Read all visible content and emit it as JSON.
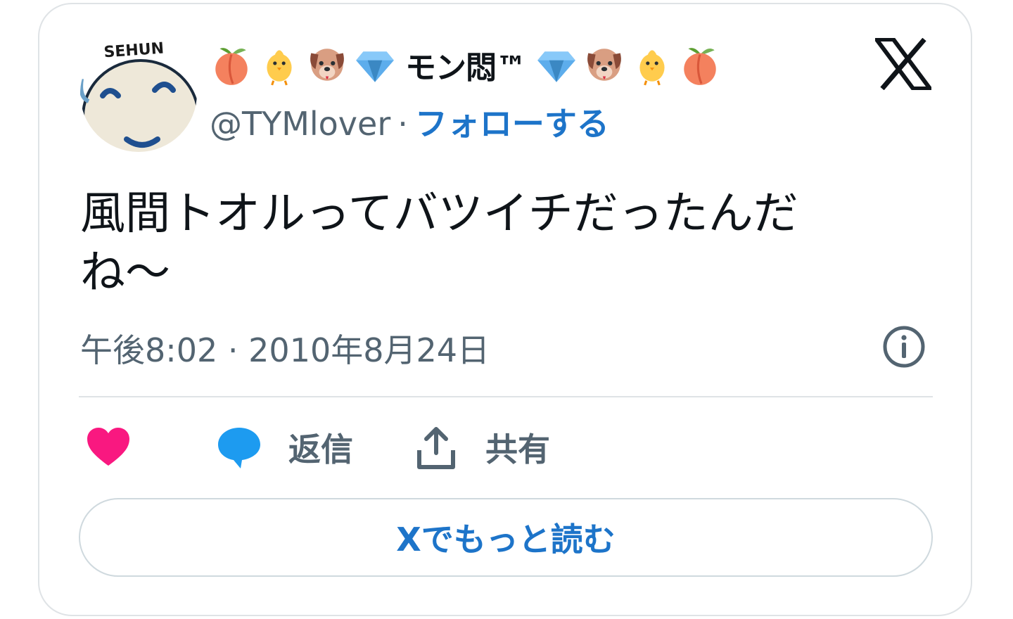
{
  "tweet": {
    "avatar_text": "SEHUN",
    "display_name": "モン悶™",
    "handle": "@TYMlover",
    "separator": "·",
    "follow_label": "フォローする",
    "text_line1": "風間トオルってバツイチだったんだ",
    "text_line2": "ね〜",
    "timestamp": "午後8:02 · 2010年8月24日"
  },
  "actions": {
    "like_icon": "heart-icon",
    "reply_label": "返信",
    "share_label": "共有"
  },
  "read_more_label": "Xでもっと読む",
  "colors": {
    "accent": "#1d74c9",
    "heart": "#f91880",
    "reply": "#1d9bf0",
    "text": "#0f1419",
    "secondary": "#536471"
  }
}
